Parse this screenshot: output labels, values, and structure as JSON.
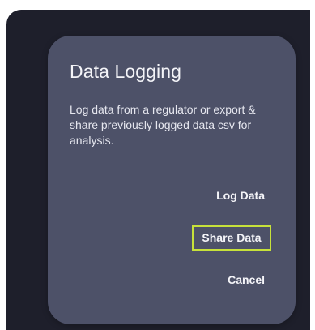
{
  "dialog": {
    "title": "Data Logging",
    "message": "Log data from a regulator or export & share previously logged data csv for analysis.",
    "actions": {
      "log_data": "Log Data",
      "share_data": "Share Data",
      "cancel": "Cancel"
    }
  },
  "colors": {
    "background": "#1e1f2b",
    "dialog": "#4d5168",
    "text": "#f4f4f8",
    "focus_ring": "#c7e13a"
  }
}
